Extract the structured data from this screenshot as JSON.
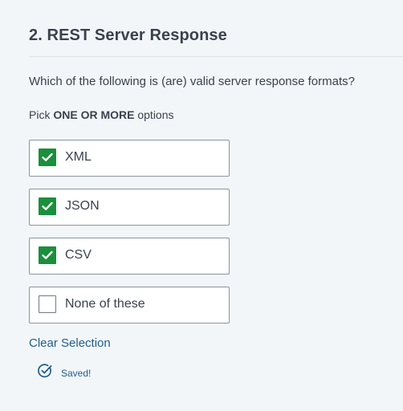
{
  "question": {
    "title": "2. REST Server Response",
    "text": "Which of the following is (are) valid server response formats?",
    "hint_prefix": "Pick ",
    "hint_bold": "ONE OR MORE",
    "hint_suffix": " options"
  },
  "options": [
    {
      "label": "XML",
      "checked": true
    },
    {
      "label": "JSON",
      "checked": true
    },
    {
      "label": "CSV",
      "checked": true
    },
    {
      "label": "None of these",
      "checked": false
    }
  ],
  "actions": {
    "clear_selection": "Clear Selection"
  },
  "status": {
    "saved_text": "Saved!",
    "icon": "check-circle-icon"
  },
  "colors": {
    "checked_fill": "#1a8f3c",
    "link": "#1f5d8c",
    "background": "#f3f6f8"
  }
}
